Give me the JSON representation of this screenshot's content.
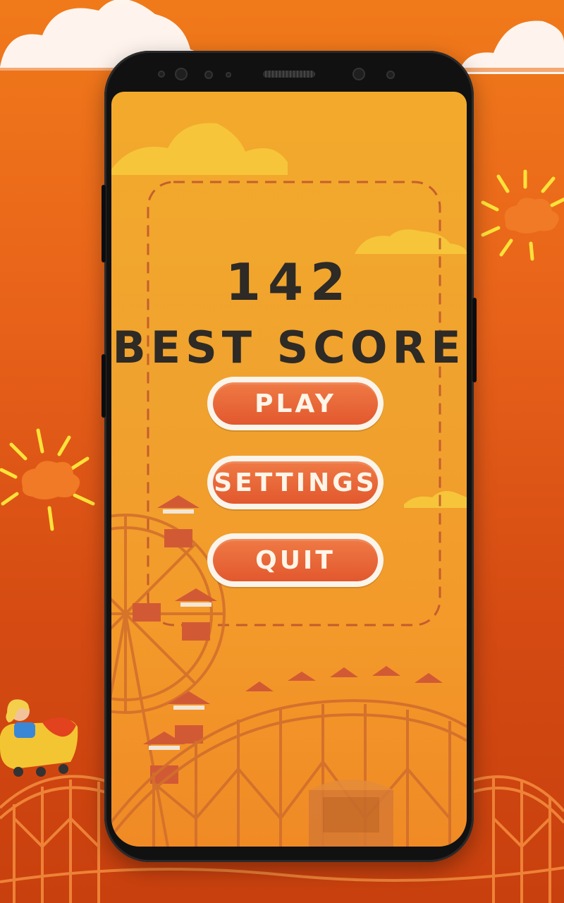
{
  "game": {
    "score": "142",
    "best_label": "BEST SCORE"
  },
  "menu": {
    "play_label": "PLAY",
    "settings_label": "SETTINGS",
    "quit_label": "QUIT"
  },
  "colors": {
    "background_orange": "#e8621a",
    "screen_yellow": "#f0a22e",
    "button_fill": "#e2582e",
    "button_border": "#fbf4ea",
    "text_dark": "#2e2a26"
  },
  "icons": [
    "sun-icon",
    "cloud-icon",
    "ferris-wheel",
    "roller-coaster",
    "coaster-rider"
  ]
}
